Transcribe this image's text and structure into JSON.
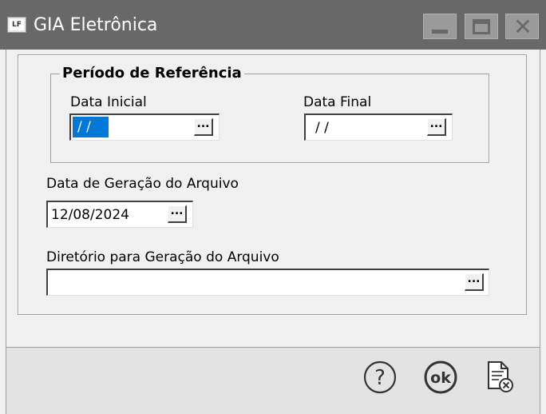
{
  "window": {
    "app_icon_text": "LF",
    "title": "GIA Eletrônica"
  },
  "reference_period": {
    "group_title": "Período de Referência",
    "start_label": "Data Inicial",
    "start_value": "/ /",
    "end_label": "Data Final",
    "end_value": "/ /"
  },
  "generation_date": {
    "label": "Data de Geração do Arquivo",
    "value": "12/08/2024"
  },
  "directory": {
    "label": "Diretório para Geração do Arquivo",
    "value": ""
  },
  "ellipsis_button_text": "...",
  "footer": {
    "help_text": "?",
    "ok_text": "ok"
  },
  "colors": {
    "titlebar": "#686868",
    "selection": "#0078d7",
    "background": "#f0f0f0"
  }
}
